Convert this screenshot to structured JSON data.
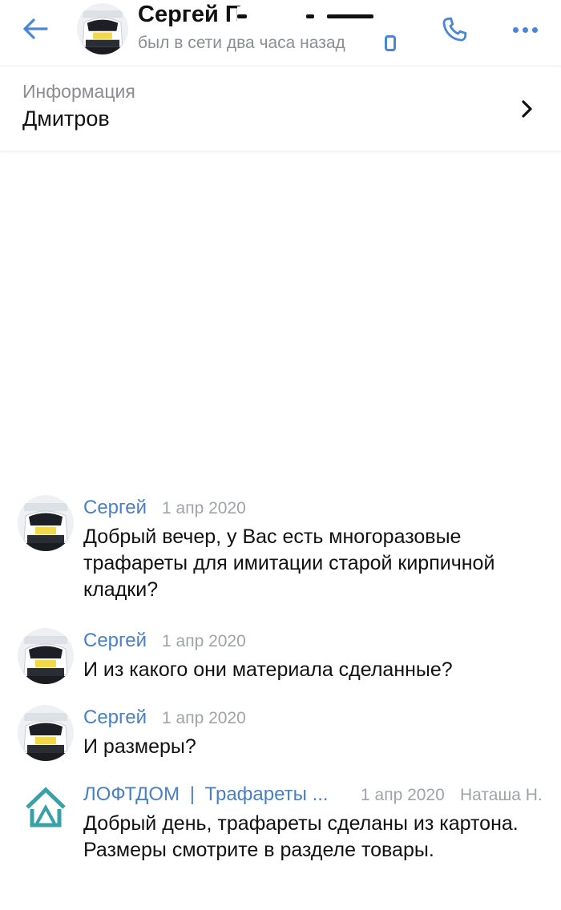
{
  "header": {
    "name": "Сергей П",
    "status": "был в сети два часа назад"
  },
  "info": {
    "label": "Информация",
    "value": "Дмитров"
  },
  "messages": [
    {
      "author": "Сергей",
      "time": "1 апр 2020",
      "text": "Добрый вечер, у Вас есть многоразовые трафареты для имитации старой кирпичной кладки?"
    },
    {
      "author": "Сергей",
      "time": "1 апр 2020",
      "text": "И из какого они материала сделанные?"
    },
    {
      "author": "Сергей",
      "time": "1 апр 2020",
      "text": "И размеры?"
    },
    {
      "author_group": "ЛОФТДОМ",
      "author_separator": "|",
      "author_page": "Трафареты ...",
      "time": "1 апр 2020",
      "signer": "Наташа Н.",
      "text": "Добрый день, трафареты сделаны из картона. Размеры смотрите в разделе товары."
    }
  ],
  "colors": {
    "accent": "#4a86d8",
    "author": "#4a7fc1",
    "secondary_text": "#8a8d91",
    "logo": "#3aa0a8"
  },
  "icons": {
    "back": "arrow-left-icon",
    "mobile": "mobile-phone-icon",
    "call": "phone-icon",
    "more": "more-dots-icon",
    "chevron": "chevron-right-icon",
    "group_logo": "house-logo-icon"
  }
}
